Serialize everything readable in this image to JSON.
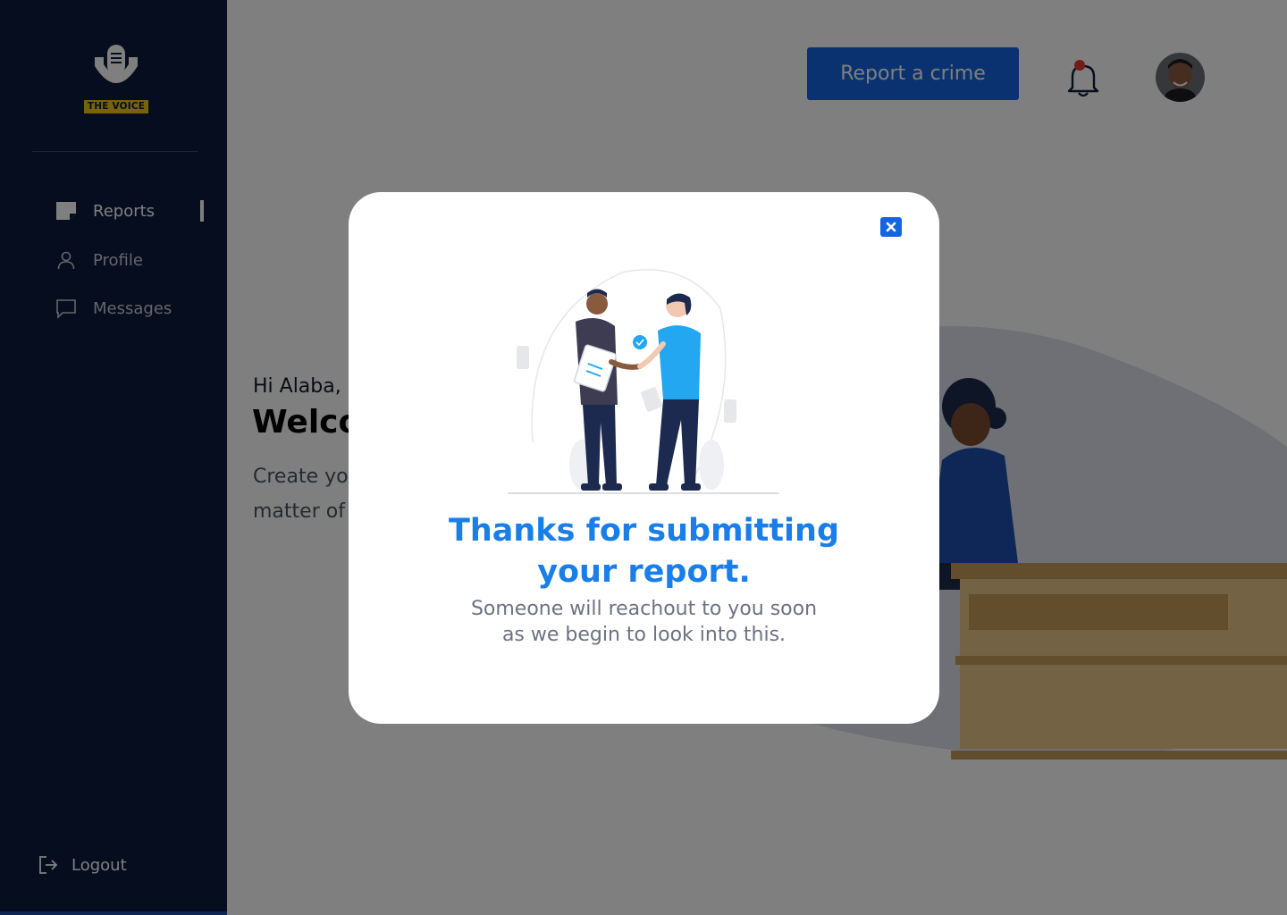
{
  "brand": {
    "logo_text": "THE VOICE",
    "logo_badge_color": "#f0c419"
  },
  "sidebar": {
    "background": "#0d1b3d",
    "items": [
      {
        "label": "Reports",
        "icon": "note-icon",
        "active": true
      },
      {
        "label": "Profile",
        "icon": "user-icon",
        "active": false
      },
      {
        "label": "Messages",
        "icon": "chat-icon",
        "active": false
      }
    ],
    "logout_label": "Logout"
  },
  "header": {
    "report_button_label": "Report a crime",
    "report_button_color": "#1565e0",
    "notification_dot_color": "#e53935"
  },
  "main": {
    "greeting": "Hi Alaba,",
    "welcome": "Welcome",
    "intro": "Create your report and get attended to in a matter of minutes or less."
  },
  "modal": {
    "title_line1": "Thanks for submitting",
    "title_line2": "your report.",
    "subtitle_line1": "Someone will reachout to you soon",
    "subtitle_line2": "as we begin to look into this.",
    "title_color": "#1a7ee8",
    "close_icon": "close-icon"
  }
}
